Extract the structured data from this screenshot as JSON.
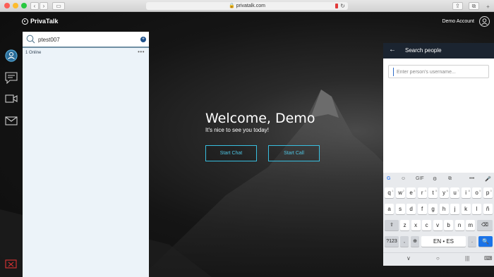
{
  "browser": {
    "url": "privatalk.com",
    "back": "‹",
    "forward": "›",
    "sidebar_glyph": "▭",
    "share_glyph": "⇪",
    "tabs_glyph": "⧉",
    "new_tab_glyph": "+"
  },
  "brand": {
    "name": "PrivaTalk"
  },
  "account": {
    "label": "Demo Account"
  },
  "chat_panel": {
    "search_value": "ptest007",
    "add_glyph": "+",
    "online_label": "1 Online",
    "more_glyph": "•••"
  },
  "welcome": {
    "title": "Welcome, Demo",
    "subtitle": "It's nice to see you today!",
    "start_chat": "Start Chat",
    "start_call": "Start Call"
  },
  "search_people": {
    "back_glyph": "←",
    "title": "Search people",
    "placeholder": "Enter person's username..."
  },
  "keyboard": {
    "toolbar": [
      "G",
      "☺",
      "GIF",
      "⚙",
      "⧉",
      "🎨",
      "•••",
      "🎤"
    ],
    "row1": [
      "q",
      "w",
      "e",
      "r",
      "t",
      "y",
      "u",
      "i",
      "o",
      "p"
    ],
    "row1_hints": [
      "1",
      "2",
      "3",
      "4",
      "5",
      "6",
      "7",
      "8",
      "9",
      "0"
    ],
    "row2": [
      "a",
      "s",
      "d",
      "f",
      "g",
      "h",
      "j",
      "k",
      "l",
      "ñ"
    ],
    "row3": [
      "z",
      "x",
      "c",
      "v",
      "b",
      "n",
      "m"
    ],
    "shift": "⇧",
    "backspace": "⌫",
    "symbols": "?123",
    "comma": ",",
    "globe": "⊕",
    "space": "EN • ES",
    "period": ".",
    "enter": "🔍"
  },
  "android_nav": {
    "back": "∨",
    "home": "○",
    "recents": "|||",
    "keyboard": "⌨"
  },
  "colors": {
    "accent": "#38bfe0",
    "header_dark": "#1b2430",
    "panel_bg": "#ecf3f9",
    "enter_key": "#1a73e8"
  }
}
